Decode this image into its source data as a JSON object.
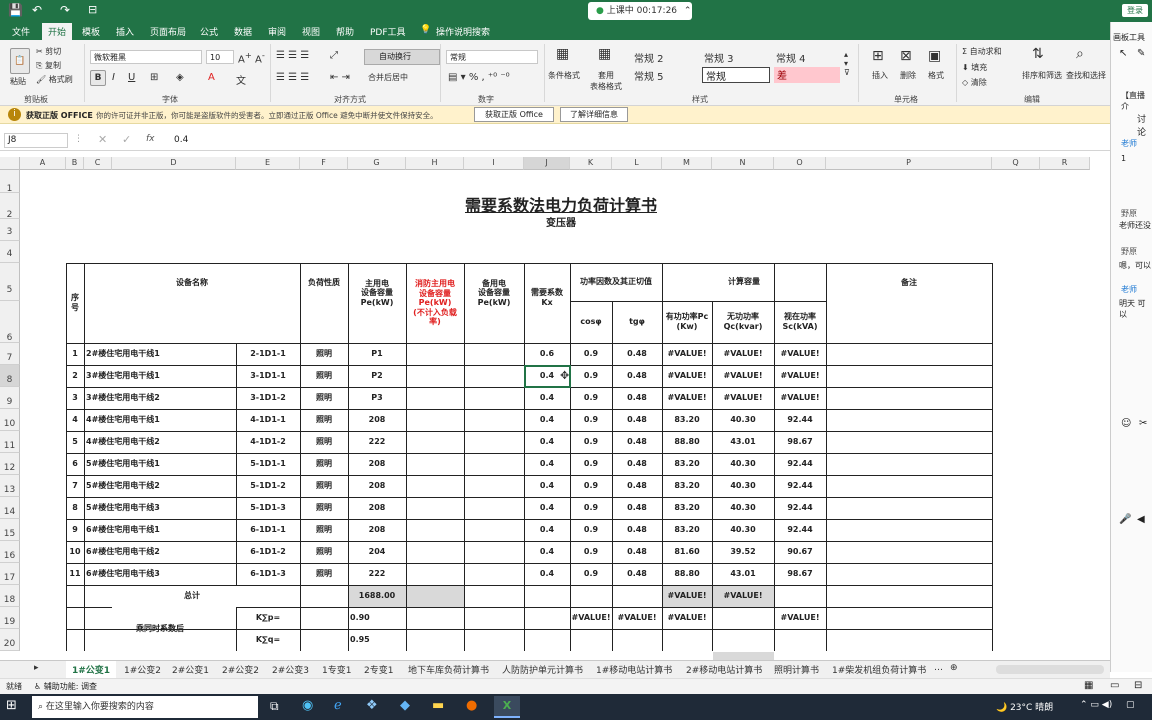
{
  "window": {
    "title_timer": "上课中 00:17:26",
    "login": "登录",
    "draw_tools": "画板工具"
  },
  "menu_tabs": [
    "文件",
    "开始",
    "模板",
    "插入",
    "页面布局",
    "公式",
    "数据",
    "审阅",
    "视图",
    "帮助",
    "PDF工具",
    "操作说明搜索"
  ],
  "ribbon": {
    "clipboard": {
      "cut": "剪切",
      "copy": "复制",
      "painter": "格式刷",
      "paste": "粘贴",
      "label": "剪贴板"
    },
    "font": {
      "name": "微软雅黑",
      "size": "10",
      "label": "字体"
    },
    "align": {
      "wrap": "自动换行",
      "merge": "合并后居中",
      "label": "对齐方式"
    },
    "number": {
      "format": "常规",
      "label": "数字"
    },
    "styles": {
      "cond": "条件格式",
      "table": "套用\n表格格式",
      "s2": "常规 2",
      "s3": "常规 3",
      "s4": "常规 4",
      "s5": "常规 5",
      "normal": "常规",
      "bad": "差",
      "label": "样式"
    },
    "cells": {
      "insert": "插入",
      "delete": "删除",
      "format": "格式",
      "label": "单元格"
    },
    "edit": {
      "autosum": "自动求和",
      "fill": "填充",
      "clear": "清除",
      "sort": "排序和筛选",
      "find": "查找和选择",
      "label": "编辑"
    }
  },
  "notice": {
    "title": "获取正版 OFFICE",
    "text": "你的许可证并非正版，你可能是盗版软件的受害者。立即通过正版 Office 避免中断并使文件保持安全。",
    "btn1": "获取正版 Office",
    "btn2": "了解详细信息"
  },
  "formula": {
    "cellref": "J8",
    "value": "0.4",
    "fx": "fx"
  },
  "columns": [
    "A",
    "B",
    "C",
    "D",
    "E",
    "F",
    "G",
    "H",
    "I",
    "J",
    "K",
    "L",
    "M",
    "N",
    "O",
    "P",
    "Q",
    "R"
  ],
  "rownums": [
    "1",
    "2",
    "3",
    "4",
    "5",
    "6",
    "7",
    "8",
    "9",
    "10",
    "11",
    "12",
    "13",
    "14",
    "15",
    "16",
    "17",
    "18",
    "19",
    "20"
  ],
  "doc": {
    "title": "需要系数法电力负荷计算书",
    "subtitle": "变压器"
  },
  "headers": {
    "seq": "序\n号",
    "name": "设备名称",
    "load": "负荷性质",
    "main": "主用电\n设备容量\nPe(kW)",
    "fire": "消防主用电\n设备容量\nPe(kW)\n(不计入负载\n率)",
    "standby": "备用电\n设备容量\nPe(kW)",
    "kx": "需要系数\nKx",
    "pf": "功率因数及其正切值",
    "cos": "cosφ",
    "tg": "tgφ",
    "calc": "计算容量",
    "pc": "有功功率Pc\n(Kw)",
    "qc": "无功功率\nQc(kvar)",
    "sc": "视在功率\nSc(kVA)",
    "note": "备注"
  },
  "rows": [
    {
      "n": "1",
      "name": "2#楼住宅用电干线1",
      "code": "2-1D1-1",
      "type": "照明",
      "pe": "P1",
      "kx": "0.6",
      "cos": "0.9",
      "tg": "0.48",
      "pc": "#VALUE!",
      "qc": "#VALUE!",
      "sc": "#VALUE!"
    },
    {
      "n": "2",
      "name": "3#楼住宅用电干线1",
      "code": "3-1D1-1",
      "type": "照明",
      "pe": "P2",
      "kx": "0.4",
      "cos": "0.9",
      "tg": "0.48",
      "pc": "#VALUE!",
      "qc": "#VALUE!",
      "sc": "#VALUE!"
    },
    {
      "n": "3",
      "name": "3#楼住宅用电干线2",
      "code": "3-1D1-2",
      "type": "照明",
      "pe": "P3",
      "kx": "0.4",
      "cos": "0.9",
      "tg": "0.48",
      "pc": "#VALUE!",
      "qc": "#VALUE!",
      "sc": "#VALUE!"
    },
    {
      "n": "4",
      "name": "4#楼住宅用电干线1",
      "code": "4-1D1-1",
      "type": "照明",
      "pe": "208",
      "kx": "0.4",
      "cos": "0.9",
      "tg": "0.48",
      "pc": "83.20",
      "qc": "40.30",
      "sc": "92.44"
    },
    {
      "n": "5",
      "name": "4#楼住宅用电干线2",
      "code": "4-1D1-2",
      "type": "照明",
      "pe": "222",
      "kx": "0.4",
      "cos": "0.9",
      "tg": "0.48",
      "pc": "88.80",
      "qc": "43.01",
      "sc": "98.67"
    },
    {
      "n": "6",
      "name": "5#楼住宅用电干线1",
      "code": "5-1D1-1",
      "type": "照明",
      "pe": "208",
      "kx": "0.4",
      "cos": "0.9",
      "tg": "0.48",
      "pc": "83.20",
      "qc": "40.30",
      "sc": "92.44"
    },
    {
      "n": "7",
      "name": "5#楼住宅用电干线2",
      "code": "5-1D1-2",
      "type": "照明",
      "pe": "208",
      "kx": "0.4",
      "cos": "0.9",
      "tg": "0.48",
      "pc": "83.20",
      "qc": "40.30",
      "sc": "92.44"
    },
    {
      "n": "8",
      "name": "5#楼住宅用电干线3",
      "code": "5-1D1-3",
      "type": "照明",
      "pe": "208",
      "kx": "0.4",
      "cos": "0.9",
      "tg": "0.48",
      "pc": "83.20",
      "qc": "40.30",
      "sc": "92.44"
    },
    {
      "n": "9",
      "name": "6#楼住宅用电干线1",
      "code": "6-1D1-1",
      "type": "照明",
      "pe": "208",
      "kx": "0.4",
      "cos": "0.9",
      "tg": "0.48",
      "pc": "83.20",
      "qc": "40.30",
      "sc": "92.44"
    },
    {
      "n": "10",
      "name": "6#楼住宅用电干线2",
      "code": "6-1D1-2",
      "type": "照明",
      "pe": "204",
      "kx": "0.4",
      "cos": "0.9",
      "tg": "0.48",
      "pc": "81.60",
      "qc": "39.52",
      "sc": "90.67"
    },
    {
      "n": "11",
      "name": "6#楼住宅用电干线3",
      "code": "6-1D1-3",
      "type": "照明",
      "pe": "222",
      "kx": "0.4",
      "cos": "0.9",
      "tg": "0.48",
      "pc": "88.80",
      "qc": "43.01",
      "sc": "98.67"
    }
  ],
  "total": {
    "label": "总计",
    "pe": "1688.00",
    "pc": "#VALUE!",
    "qc": "#VALUE!"
  },
  "coef": {
    "label": "乘同时系数后",
    "kp": "K∑p=",
    "kq": "K∑q=",
    "kp_val": "0.90",
    "kq_val": "0.95",
    "k": "#VALUE!",
    "l": "#VALUE!",
    "m": "#VALUE!",
    "o": "#VALUE!"
  },
  "sheet_tabs": [
    "1#公变1",
    "1#公变2",
    "2#公变1",
    "2#公变2",
    "2#公变3",
    "1专变1",
    "2专变1",
    "地下车库负荷计算书",
    "人防防护单元计算书",
    "1#移动电站计算书",
    "2#移动电站计算书",
    "照明计算书",
    "1#柴发机组负荷计算书"
  ],
  "status": {
    "ready": "就绪",
    "access": "辅助功能: 调查"
  },
  "taskbar": {
    "search": "在这里输入你要搜索的内容",
    "weather": "23°C 晴朗"
  },
  "rightpanel": {
    "live": "【直播介",
    "discuss": "讨论",
    "teacher": "老师",
    "msg1": "1",
    "user1": "野原",
    "msg2": "老师还没",
    "user2": "野原",
    "msg3": "嗯，可以",
    "teacher2": "老师",
    "msg4": "明天 可以"
  },
  "colors": {
    "excel_green": "#217346",
    "fire_red": "#e02020",
    "bad_fill": "#ffc7ce",
    "notice_bg": "#fff2cc"
  }
}
